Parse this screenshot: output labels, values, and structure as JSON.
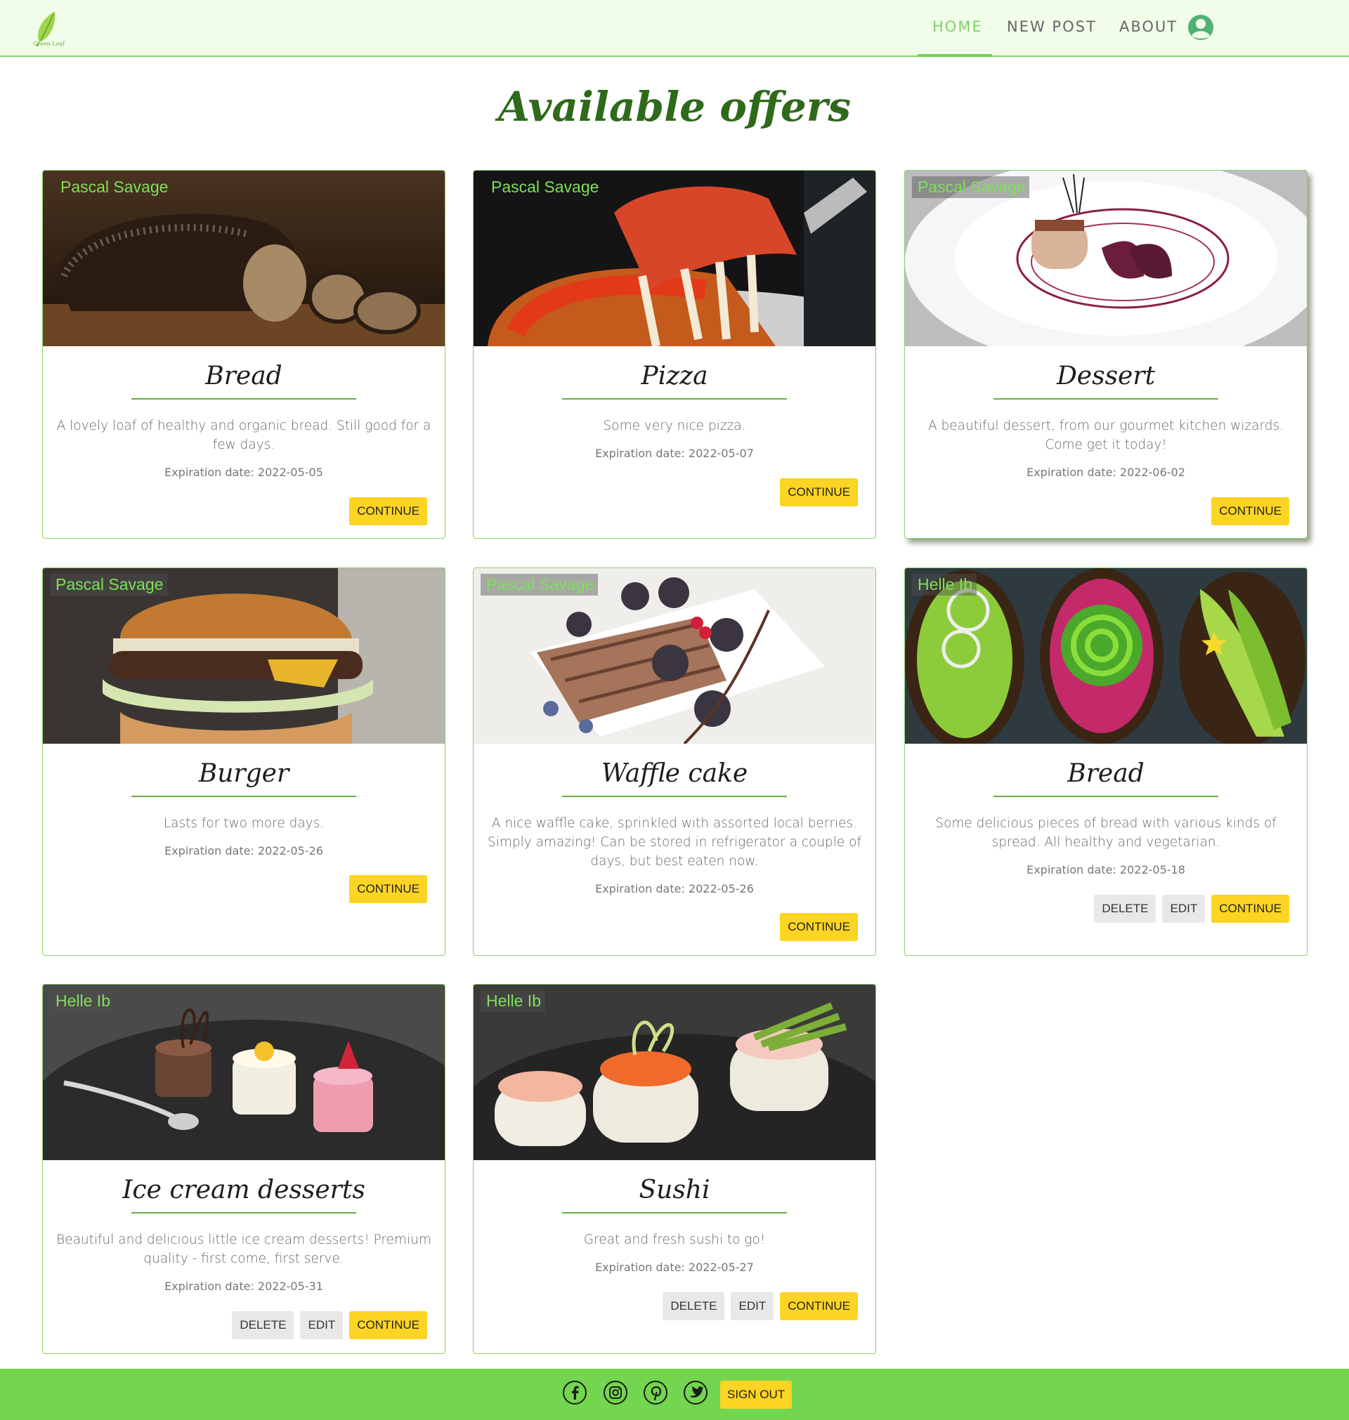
{
  "navbar": {
    "logo_text": "Green Leaf",
    "items": [
      {
        "label": "HOME"
      },
      {
        "label": "NEW POST"
      },
      {
        "label": "ABOUT"
      }
    ],
    "active_item": "HOME",
    "avatar_icon": "user-circle-icon"
  },
  "page": {
    "title": "Available offers"
  },
  "actions": {
    "delete": "DELETE",
    "edit": "EDIT",
    "continue": "CONTINUE"
  },
  "cards": [
    {
      "author": "Pascal Savage",
      "title": "Bread",
      "description": "A lovely loaf of healthy and organic bread. Still good for a few days.",
      "expiration": "Expiration date: 2022-05-05",
      "image": "bread-loaf-photo"
    },
    {
      "author": "Pascal Savage",
      "title": "Pizza",
      "description": "Some very nice pizza.",
      "expiration": "Expiration date: 2022-05-07",
      "image": "pizza-photo"
    },
    {
      "author": "Pascal Savage",
      "title": "Dessert",
      "description": "A beautiful dessert, from our gourmet kitchen wizards. Come get it today!",
      "expiration": "Expiration date: 2022-06-02",
      "image": "plated-dessert-photo"
    },
    {
      "author": "Pascal Savage",
      "title": "Burger",
      "description": "Lasts for two more days.",
      "expiration": "Expiration date: 2022-05-26",
      "image": "burger-photo"
    },
    {
      "author": "Pascal Savage",
      "title": "Waffle cake",
      "description": "A nice waffle cake, sprinkled with assorted local berries. Simply amazing! Can be stored in refrigerator a couple of days, but best eaten now.",
      "expiration": "Expiration date: 2022-05-26",
      "image": "waffle-cake-photo"
    },
    {
      "author": "Helle Ib",
      "title": "Bread",
      "description": "Some delicious pieces of bread with various kinds of spread. All healthy and vegetarian.",
      "expiration": "Expiration date: 2022-05-18",
      "image": "avocado-toast-photo"
    },
    {
      "author": "Helle Ib",
      "title": "Ice cream desserts",
      "description": "Beautiful and delicious little ice cream desserts! Premium quality - first come, first serve.",
      "expiration": "Expiration date: 2022-05-31",
      "image": "ice-cream-desserts-photo"
    },
    {
      "author": "Helle Ib",
      "title": "Sushi",
      "description": "Great and fresh sushi to go!",
      "expiration": "Expiration date: 2022-05-27",
      "image": "sushi-photo"
    }
  ],
  "footer": {
    "social_icons": [
      "facebook-icon",
      "instagram-icon",
      "pinterest-icon",
      "twitter-icon"
    ],
    "sign_out": "SIGN OUT"
  },
  "colors": {
    "accent_green": "#74d54f",
    "nav_bg": "#f1fde9",
    "button_yellow": "#fcd423",
    "title_green": "#2f6a1a"
  }
}
